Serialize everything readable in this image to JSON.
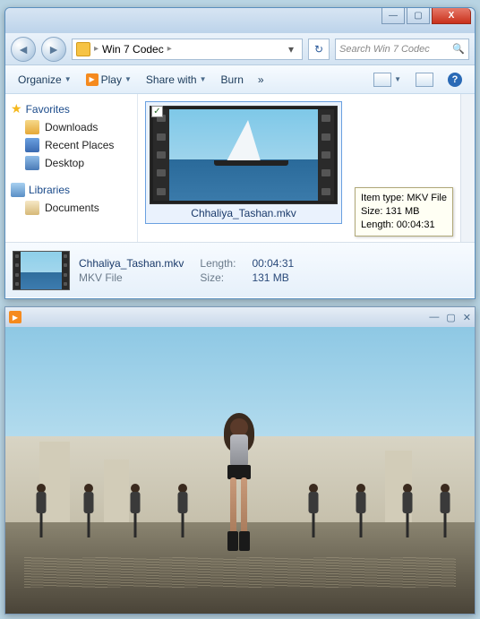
{
  "explorer": {
    "title": "",
    "window_buttons": {
      "min": "—",
      "max": "▢",
      "close": "X"
    },
    "breadcrumb": {
      "folder": "Win 7 Codec",
      "sep": "▸",
      "dropdown": "▾"
    },
    "search": {
      "placeholder": "Search Win 7 Codec",
      "icon": "🔍",
      "refresh": "↻"
    },
    "toolbar": {
      "organize": "Organize",
      "play": "Play",
      "share": "Share with",
      "burn": "Burn",
      "more": "»",
      "help": "?"
    },
    "sidebar": {
      "favorites": "Favorites",
      "items_fav": [
        "Downloads",
        "Recent Places",
        "Desktop"
      ],
      "libraries": "Libraries",
      "items_lib": [
        "Documents"
      ]
    },
    "file": {
      "name": "Chhaliya_Tashan.mkv",
      "type": "MKV File",
      "length_label": "Length:",
      "length": "00:04:31",
      "size_label": "Size:",
      "size": "131 MB",
      "check": "✓"
    },
    "tooltip": {
      "l1_k": "Item type:",
      "l1_v": "MKV File",
      "l2_k": "Size:",
      "l2_v": "131 MB",
      "l3_k": "Length:",
      "l3_v": "00:04:31"
    }
  },
  "player": {
    "window_buttons": {
      "min": "—",
      "max": "▢",
      "close": "✕"
    }
  }
}
